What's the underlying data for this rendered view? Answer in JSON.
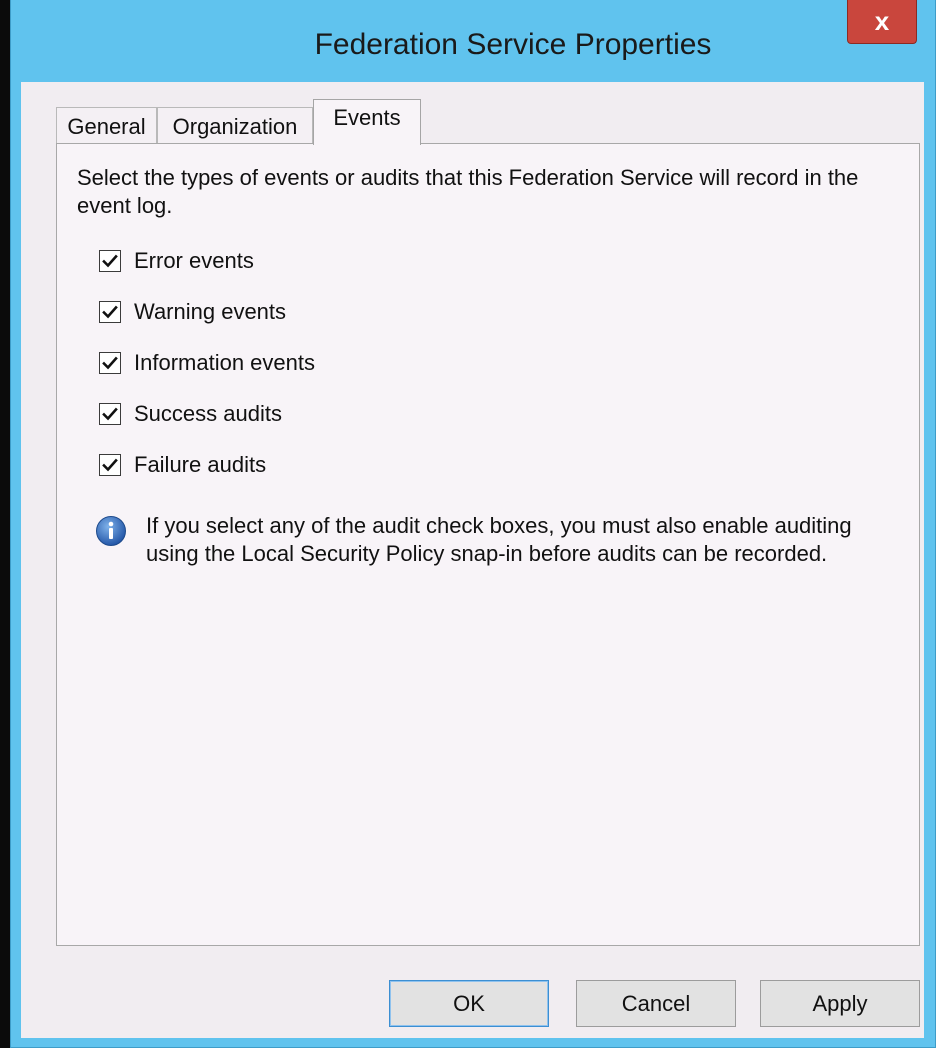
{
  "window": {
    "title": "Federation Service Properties",
    "close_glyph": "x"
  },
  "tabs": [
    {
      "label": "General",
      "active": false
    },
    {
      "label": "Organization",
      "active": false
    },
    {
      "label": "Events",
      "active": true
    }
  ],
  "events_tab": {
    "intro": "Select the types of events or audits that this Federation Service will record in the event log.",
    "checkboxes": [
      {
        "label": "Error events",
        "checked": true
      },
      {
        "label": "Warning events",
        "checked": true
      },
      {
        "label": "Information events",
        "checked": true
      },
      {
        "label": "Success audits",
        "checked": true
      },
      {
        "label": "Failure audits",
        "checked": true
      }
    ],
    "info_icon": "info-icon",
    "info_text": "If you select any of the audit check boxes, you must also enable auditing using the Local Security Policy snap-in before audits can be recorded."
  },
  "buttons": {
    "ok": "OK",
    "cancel": "Cancel",
    "apply": "Apply"
  },
  "colors": {
    "title_bar": "#60c3ee",
    "close_button": "#c9463d",
    "client_bg": "#f1edf1",
    "info_icon_blue": "#2f6fc4"
  }
}
